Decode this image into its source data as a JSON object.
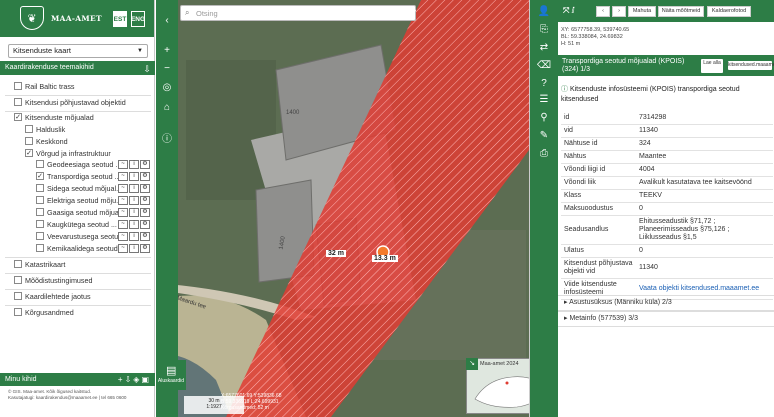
{
  "brand": {
    "name": "MAA-AMET",
    "lang_est": "EST",
    "lang_eng": "ENG"
  },
  "left": {
    "map_select": "Kitsenduste kaart",
    "section_title": "Kaardirakenduse teemakihid",
    "layers": [
      {
        "label": "Rail Baltic trass",
        "checked": false
      },
      {
        "label": "Kitsendusi põhjustavad objektid",
        "checked": false
      },
      {
        "label": "Kitsenduste mõjualad",
        "checked": true
      },
      {
        "label": "Halduslik",
        "checked": false
      },
      {
        "label": "Keskkond",
        "checked": false
      },
      {
        "label": "Võrgud ja infrastruktuur",
        "checked": true
      },
      {
        "label": "Geodeesiaga seotud ...",
        "checked": false
      },
      {
        "label": "Transpordiga seotud ...",
        "checked": true
      },
      {
        "label": "Sidega seotud mõjual...",
        "checked": false
      },
      {
        "label": "Elektriga seotud mõju...",
        "checked": false
      },
      {
        "label": "Gaasiga seotud mõjua...",
        "checked": false
      },
      {
        "label": "Kaugkütega seotud ...",
        "checked": false
      },
      {
        "label": "Veevarustusega seotu...",
        "checked": false
      },
      {
        "label": "Kemikaalidega seotud...",
        "checked": false
      },
      {
        "label": "Katastrikaart",
        "checked": false
      },
      {
        "label": "Mõõdistustingimused",
        "checked": false
      },
      {
        "label": "Kaardilehtede jaotus",
        "checked": false
      },
      {
        "label": "Kõrgusandmed",
        "checked": false
      }
    ],
    "my_layers": "Minu kihid",
    "footer_line1": "© GIS. Maa-amet. Kõik õigused kaitstud.",
    "footer_line2": "Kasutajatugi: kaardirakendus@maaamet.ee | tel 665 0600"
  },
  "map": {
    "search_placeholder": "Otsing",
    "basemap_label": "Aluskaardid",
    "scale_m": "30 m",
    "scale_ratio": "1:1927",
    "coord_line1": "X:6577601.69 Y:539836.68",
    "coord_line2": "B:59.336919 L:24.699931",
    "coord_line3": "Kõrgusandmed: 52 m",
    "road_label": "Maardu tee",
    "measure_1": "32 m",
    "measure_2": "13.3 m",
    "minimap_label": "Maa-amet 2024",
    "building_label_1": "1400",
    "building_label_2": "1400"
  },
  "right": {
    "toolbar_btns": [
      "Mahuta",
      "Näita mõõtmeid",
      "Kaldaerofotod"
    ],
    "xy_line1": "XY: 6577758.39, 539740.65",
    "xy_line2": "BL: 59.338084, 24.69832",
    "xy_line3": "H: 51 m",
    "object_title": "Transpordiga seotud mõjualad (KPOIS) (324) 1/3",
    "btn_lae": "Lae alla",
    "btn_link": "kitsendused.maaamet.ee",
    "heading": "Kitsenduste infosüsteemi (KPOIS) transpordiga seotud kitsendused",
    "rows": [
      {
        "k": "id",
        "v": "7314298"
      },
      {
        "k": "vid",
        "v": "11340"
      },
      {
        "k": "Nähtuse id",
        "v": "324"
      },
      {
        "k": "Nähtus",
        "v": "Maantee"
      },
      {
        "k": "Võondi liigi id",
        "v": "4004"
      },
      {
        "k": "Võondi liik",
        "v": "Avalikult kasutatava tee kaitsevöönd"
      },
      {
        "k": "Klass",
        "v": "TEEKV"
      },
      {
        "k": "Maksuoodustus",
        "v": "0"
      },
      {
        "k": "Seadusandlus",
        "v": "Ehitusseadustik §71,72 ; Planeerimisseadus §75,126 ; Liiklusseadus §1,5"
      },
      {
        "k": "Ulatus",
        "v": "0"
      },
      {
        "k": "Kitsendust põhjustava objekti vid",
        "v": "11340"
      },
      {
        "k": "Viide kitsenduste infosüsteemi",
        "v": "Vaata objekti kitsendused.maaamet.ee"
      }
    ],
    "accordion_1": "Asustusüksus (Männiku küla) 2/3",
    "accordion_2": "Metainfo (577539) 3/3"
  }
}
